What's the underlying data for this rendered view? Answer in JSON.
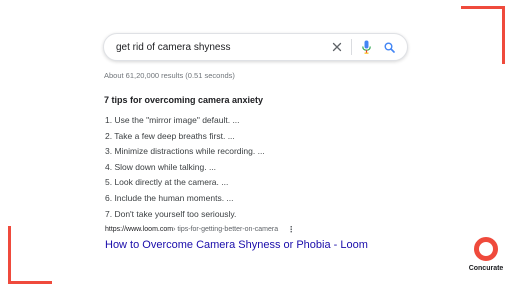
{
  "colors": {
    "accent": "#ef4a3c",
    "link": "#1a0dab",
    "mic_blue": "#4285f4",
    "mic_red": "#ea4335"
  },
  "search": {
    "query": "get rid of camera shyness",
    "icons": [
      "clear-icon",
      "microphone-icon",
      "search-icon"
    ]
  },
  "results_stats": "About 61,20,000 results (0.51 seconds)",
  "featured_snippet": {
    "title": "7 tips for overcoming camera anxiety",
    "items": [
      "1. Use the \"mirror image\" default. ...",
      "2. Take a few deep breaths first. ...",
      "3. Minimize distractions while recording. ...",
      "4. Slow down while talking. ...",
      "5. Look directly at the camera. ...",
      "6. Include the human moments. ...",
      "7. Don't take yourself too seriously."
    ]
  },
  "result": {
    "url": "https://www.loom.com",
    "breadcrumb": " › tips-for-getting-better-on-camera",
    "more_icon": "more-vert-icon",
    "title": "How to Overcome Camera Shyness or Phobia - Loom"
  },
  "brand": {
    "logo_text": "Concurate"
  }
}
